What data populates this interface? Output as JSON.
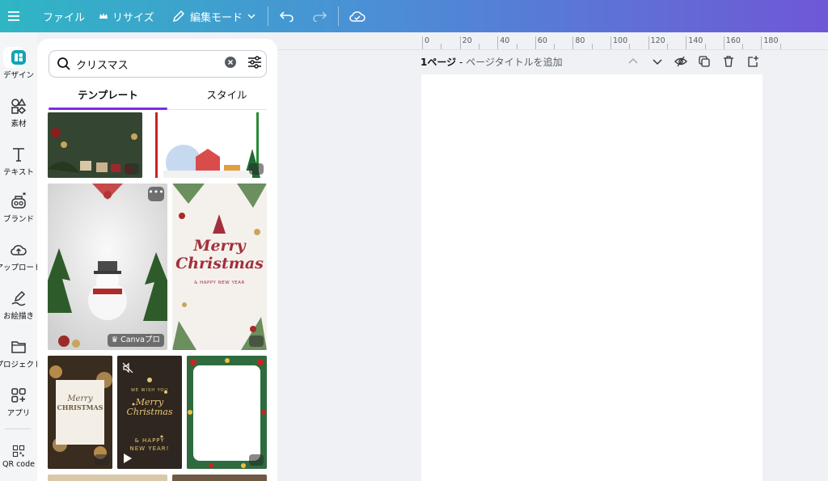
{
  "topbar": {
    "menu_icon": "hamburger-icon",
    "file_label": "ファイル",
    "resize_label": "リサイズ",
    "edit_mode_label": "編集モード",
    "undo_icon": "undo-icon",
    "redo_icon": "redo-icon",
    "cloud_icon": "cloud-saved-icon"
  },
  "rail": {
    "items": [
      {
        "label": "デザイン",
        "icon": "design-icon"
      },
      {
        "label": "素材",
        "icon": "elements-icon"
      },
      {
        "label": "テキスト",
        "icon": "text-icon"
      },
      {
        "label": "ブランド",
        "icon": "brand-icon"
      },
      {
        "label": "アップロード",
        "icon": "upload-icon"
      },
      {
        "label": "お絵描き",
        "icon": "draw-icon"
      },
      {
        "label": "プロジェクト",
        "icon": "folder-icon"
      },
      {
        "label": "アプリ",
        "icon": "apps-icon"
      },
      {
        "label": "QR code",
        "icon": "qr-code-icon"
      }
    ]
  },
  "panel": {
    "search": {
      "value": "クリスマス",
      "placeholder": ""
    },
    "tabs": [
      {
        "label": "テンプレート",
        "active": true
      },
      {
        "label": "スタイル",
        "active": false
      }
    ],
    "thumbnails": {
      "merry_christmas_text": [
        "Merry",
        "Christmas"
      ],
      "happy_new_year": "& HAPPY NEW YEAR",
      "canva_pro_badge": "Canvaプロ",
      "more_label": "•••",
      "merry_christmas_caps": [
        "Merry",
        "CHRISTMAS"
      ],
      "wish_you": "WE WISH YOU",
      "merry_christmas_gold": [
        "Merry",
        "Christmas"
      ],
      "happy_new_year_gold": [
        "& HAPPY",
        "NEW YEAR!"
      ]
    }
  },
  "canvas": {
    "ruler_ticks": [
      "0",
      "20",
      "40",
      "60",
      "80",
      "100",
      "120",
      "140",
      "160",
      "180"
    ],
    "page_label": "1ページ",
    "page_title_placeholder": "ページタイトルを追加",
    "page_separator": " - "
  },
  "colors": {
    "accent": "#7d2ae8",
    "topbar_start": "#2fb6c4",
    "topbar_end": "#6f57d6"
  }
}
